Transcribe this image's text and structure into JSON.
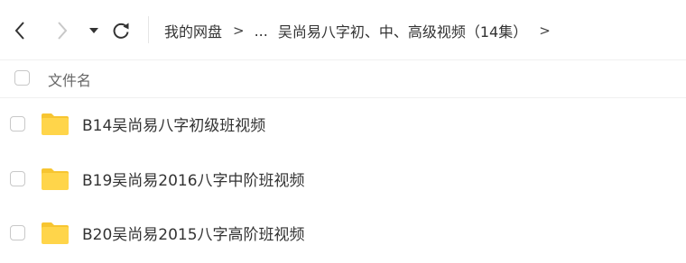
{
  "toolbar": {
    "back_icon": "chevron-left-icon",
    "forward_icon": "chevron-right-icon",
    "history_icon": "caret-down-icon",
    "refresh_icon": "refresh-icon"
  },
  "breadcrumb": {
    "root": "我的网盘",
    "separator": ">",
    "ellipsis": "...",
    "current": "吴尚易八字初、中、高级视频（14集）",
    "trailing_separator": ">"
  },
  "list_header": {
    "name_column": "文件名"
  },
  "files": [
    {
      "name": "B14吴尚易八字初级班视频",
      "icon": "folder-icon"
    },
    {
      "name": "B19吴尚易2016八字中阶班视频",
      "icon": "folder-icon"
    },
    {
      "name": "B20吴尚易2015八字高阶班视频",
      "icon": "folder-icon"
    }
  ],
  "colors": {
    "folder": "#ffd54a",
    "folder_tab": "#f7c531",
    "icon_active": "#333333",
    "icon_disabled": "#c8c8c8",
    "divider": "#f0f0f0"
  }
}
